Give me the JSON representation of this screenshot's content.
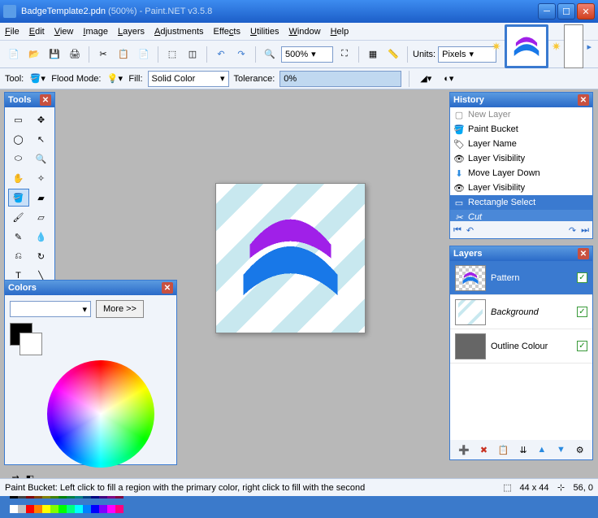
{
  "title": {
    "filename": "BadgeTemplate2.pdn",
    "zoom_in_title": "(500%)",
    "sep": "-",
    "app": "Paint.NET v3.5.8"
  },
  "menu": [
    "File",
    "Edit",
    "View",
    "Image",
    "Layers",
    "Adjustments",
    "Effects",
    "Utilities",
    "Window",
    "Help"
  ],
  "toolbar": {
    "zoom_value": "500%",
    "units_label": "Units:",
    "units_value": "Pixels"
  },
  "subbar": {
    "tool_label": "Tool:",
    "flood_label": "Flood Mode:",
    "fill_label": "Fill:",
    "fill_value": "Solid Color",
    "tolerance_label": "Tolerance:",
    "tolerance_value": "0%"
  },
  "tools_title": "Tools",
  "colors_title": "Colors",
  "colors_more": "More >>",
  "history": {
    "title": "History",
    "items": [
      "New Layer",
      "Paint Bucket",
      "Layer Name",
      "Layer Visibility",
      "Move Layer Down",
      "Layer Visibility",
      "Rectangle Select",
      "Cut"
    ]
  },
  "layers": {
    "title": "Layers",
    "items": [
      {
        "name": "Pattern",
        "checked": true
      },
      {
        "name": "Background",
        "checked": true,
        "italic": true
      },
      {
        "name": "Outline Colour",
        "checked": true
      }
    ]
  },
  "status": {
    "hint": "Paint Bucket: Left click to fill a region with the primary color, right click to fill with the second",
    "size": "44 x 44",
    "pos": "56, 0"
  }
}
